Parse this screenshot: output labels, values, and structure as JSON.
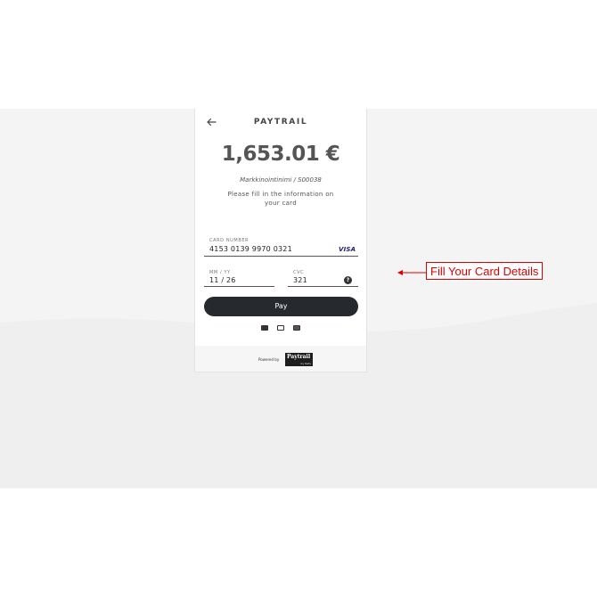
{
  "header": {
    "brand": "PAYTRAIL",
    "back_icon": "arrow-left-icon"
  },
  "payment": {
    "amount": "1,653.01 €",
    "reference": "Markkinointinimi / S00038",
    "instructions": "Please fill in the information on your card"
  },
  "card_form": {
    "card_number_label": "CARD NUMBER",
    "card_number_value": "4153 0139 9970 0321",
    "card_brand": "VISA",
    "expiry_label": "MM / YY",
    "expiry_value": "11 / 26",
    "cvc_label": "CVC",
    "cvc_value": "321",
    "help_glyph": "?"
  },
  "pay_button": {
    "label": "Pay"
  },
  "payment_method_icons": [
    "card-icon",
    "laptop-icon",
    "wallet-icon"
  ],
  "footer": {
    "powered_by": "Powered by",
    "logo_name": "Paytrail",
    "logo_sub": "by Nets"
  },
  "annotation": {
    "text": "Fill Your Card Details",
    "color": "#e00000"
  },
  "colors": {
    "pay_button": "#26292e",
    "visa": "#1a1f71",
    "background_band": "#f4f4f4"
  }
}
